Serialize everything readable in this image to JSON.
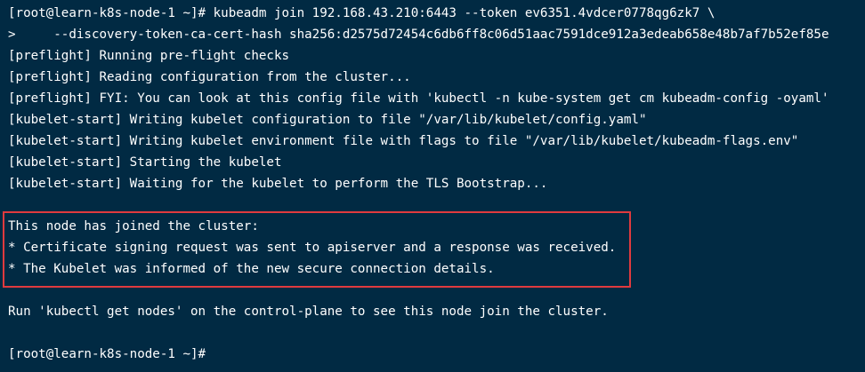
{
  "terminal": {
    "lines": [
      "[root@learn-k8s-node-1 ~]# kubeadm join 192.168.43.210:6443 --token ev6351.4vdcer0778qg6zk7 \\",
      ">     --discovery-token-ca-cert-hash sha256:d2575d72454c6db6ff8c06d51aac7591dce912a3edeab658e48b7af7b52ef85e",
      "[preflight] Running pre-flight checks",
      "[preflight] Reading configuration from the cluster...",
      "[preflight] FYI: You can look at this config file with 'kubectl -n kube-system get cm kubeadm-config -oyaml'",
      "[kubelet-start] Writing kubelet configuration to file \"/var/lib/kubelet/config.yaml\"",
      "[kubelet-start] Writing kubelet environment file with flags to file \"/var/lib/kubelet/kubeadm-flags.env\"",
      "[kubelet-start] Starting the kubelet",
      "[kubelet-start] Waiting for the kubelet to perform the TLS Bootstrap...",
      "This node has joined the cluster:",
      "* Certificate signing request was sent to apiserver and a response was received.",
      "* The Kubelet was informed of the new secure connection details.",
      "Run 'kubectl get nodes' on the control-plane to see this node join the cluster.",
      "[root@learn-k8s-node-1 ~]#"
    ]
  },
  "colors": {
    "background": "#012a43",
    "text": "#ffffff",
    "highlight_border": "#e03a3e"
  }
}
